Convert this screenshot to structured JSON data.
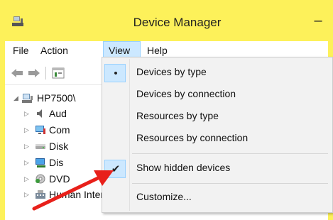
{
  "window": {
    "title": "Device Manager",
    "minimize_glyph": "–"
  },
  "menubar": {
    "items": [
      {
        "label": "File"
      },
      {
        "label": "Action"
      },
      {
        "label": "View",
        "active": true
      },
      {
        "label": "Help"
      }
    ]
  },
  "toolbar": {
    "buttons": [
      "back-arrow-icon",
      "forward-arrow-icon",
      "properties-icon"
    ]
  },
  "tree": {
    "root": {
      "label": "HP7500\\",
      "icon": "computer-icon",
      "expanded": true
    },
    "children": [
      {
        "label": "Aud",
        "icon": "audio-icon"
      },
      {
        "label": "Com",
        "icon": "computer-icon"
      },
      {
        "label": "Disk",
        "icon": "disk-drive-icon"
      },
      {
        "label": "Dis",
        "icon": "display-adapter-icon"
      },
      {
        "label": "DVD",
        "icon": "dvd-drive-icon"
      },
      {
        "label": "Human Interface Devices",
        "icon": "hid-icon"
      }
    ]
  },
  "view_menu": {
    "items": [
      {
        "label": "Devices by type",
        "mark": "•",
        "checked": true
      },
      {
        "label": "Devices by connection",
        "mark": ""
      },
      {
        "label": "Resources by type",
        "mark": ""
      },
      {
        "label": "Resources by connection",
        "mark": ""
      },
      {
        "label": "Show hidden devices",
        "mark": "✔",
        "checked": true
      },
      {
        "label": "Customize...",
        "mark": ""
      }
    ]
  },
  "colors": {
    "highlight_border": "#fdf15a",
    "menu_active_bg": "#cce8ff",
    "annotation_arrow": "#e8201a"
  }
}
